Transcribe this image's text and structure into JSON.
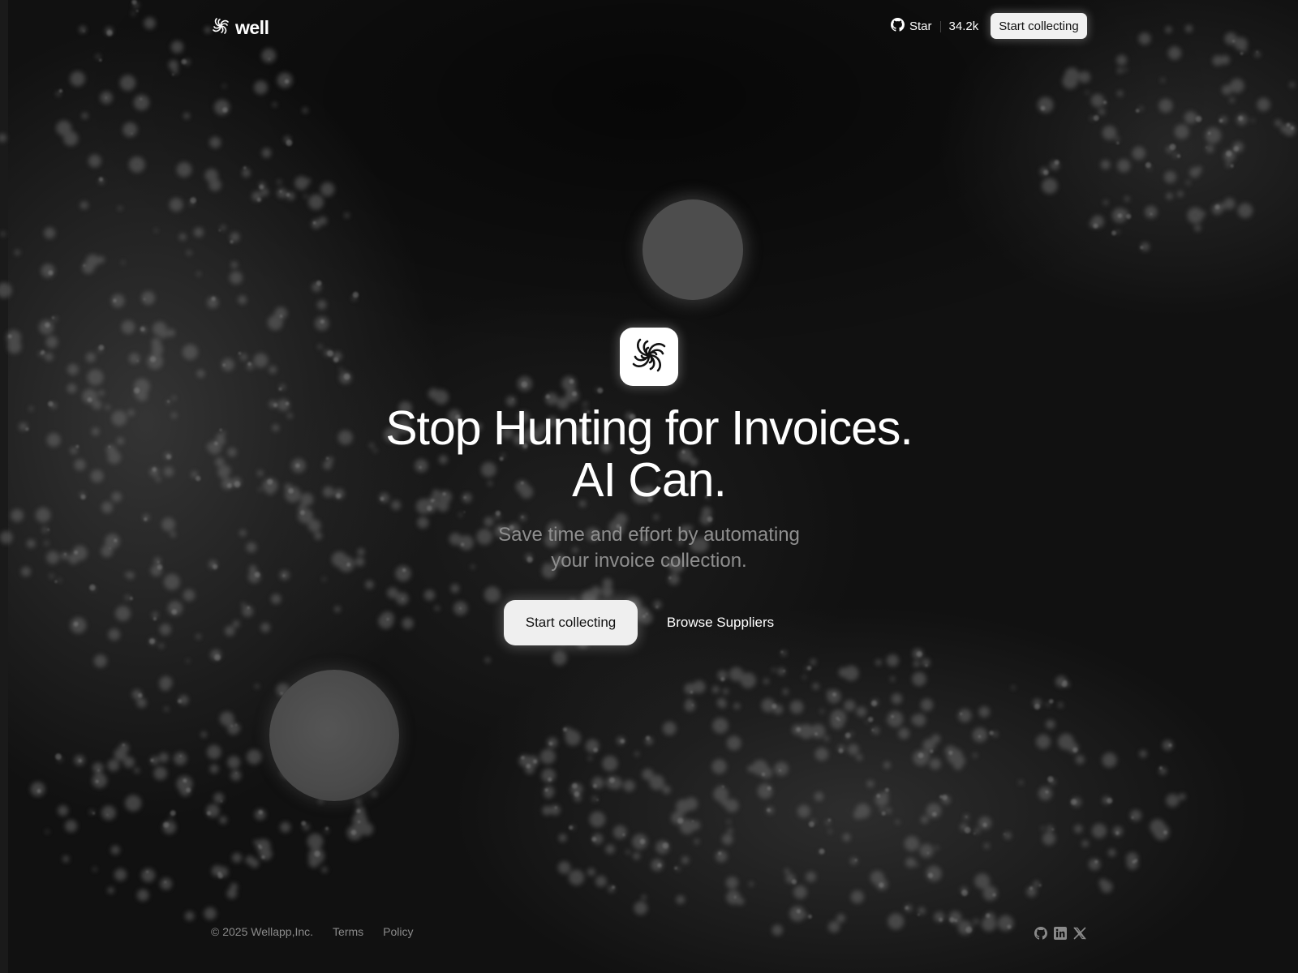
{
  "header": {
    "logo_text": "well",
    "github_star_label": "Star",
    "github_star_count": "34.2k",
    "cta_label": "Start collecting"
  },
  "hero": {
    "headline_line1": "Stop Hunting for Invoices.",
    "headline_line2": "AI Can.",
    "subtitle_line1": "Save time and effort by automating",
    "subtitle_line2": "your invoice collection.",
    "primary_cta": "Start collecting",
    "secondary_cta": "Browse Suppliers"
  },
  "footer": {
    "copyright": "© 2025 Wellapp,Inc.",
    "terms": "Terms",
    "policy": "Policy",
    "social_icons": [
      "github-icon",
      "linkedin-icon",
      "x-icon"
    ]
  },
  "colors": {
    "background": "#111111",
    "text_primary": "#ffffff",
    "text_muted": "#8e8e8e",
    "button_light": "#f1f1f1"
  }
}
